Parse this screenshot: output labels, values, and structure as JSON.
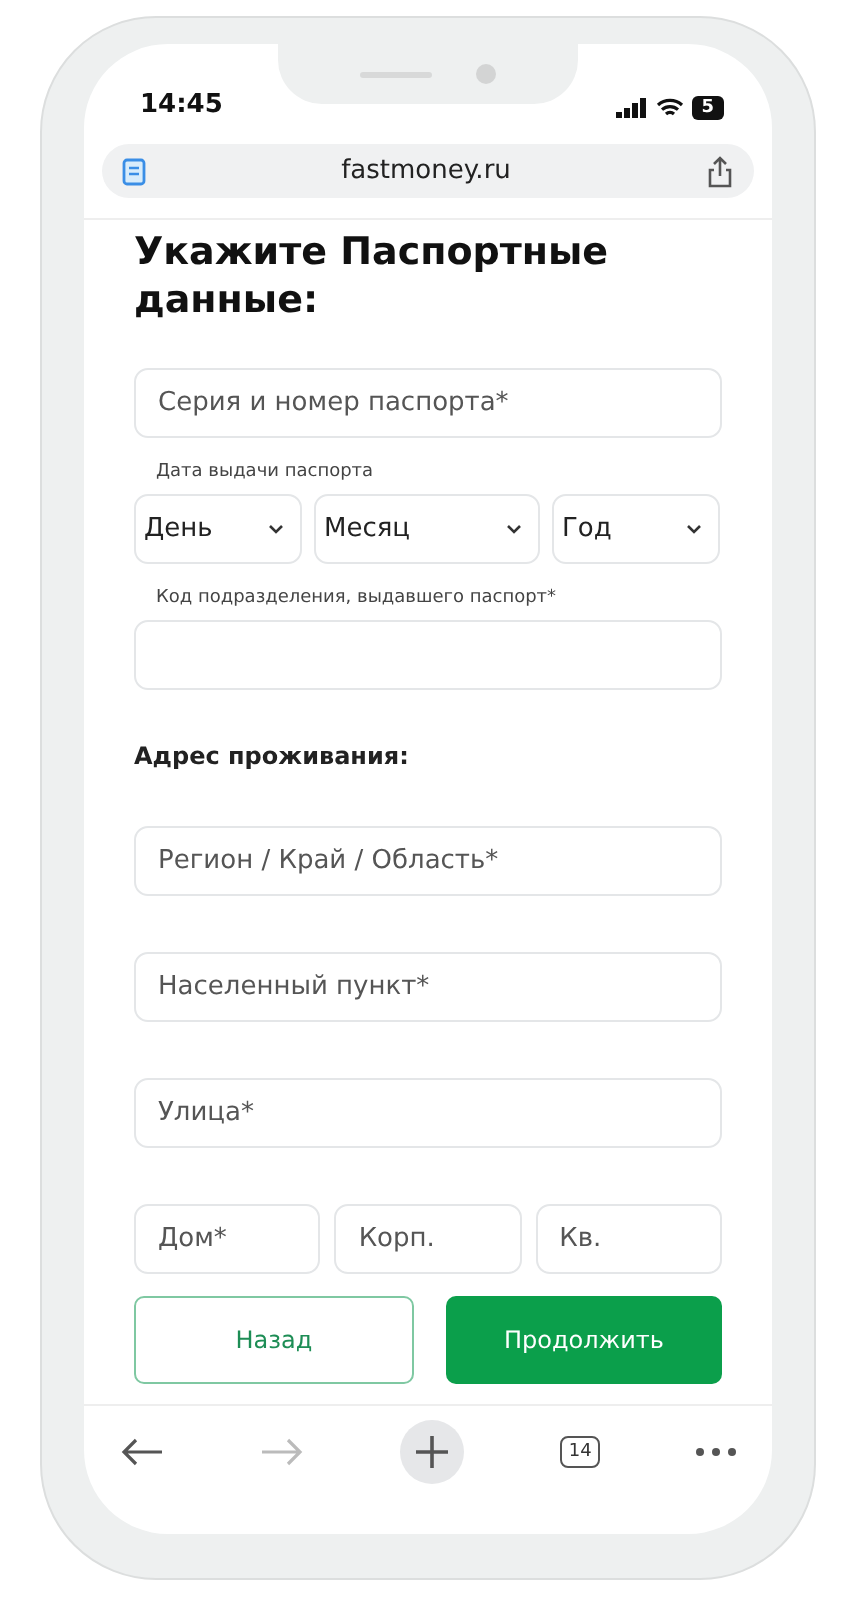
{
  "status_bar": {
    "time": "14:45",
    "battery": "5"
  },
  "address_bar": {
    "url": "fastmoney.ru"
  },
  "form": {
    "title": "Укажите Паспортные данные:",
    "passport_number": {
      "placeholder": "Серия и номер паспорта*"
    },
    "issue_date": {
      "label": "Дата выдачи паспорта",
      "selects": [
        {
          "placeholder": "День"
        },
        {
          "placeholder": "Месяц"
        },
        {
          "placeholder": "Год"
        }
      ]
    },
    "division_code": {
      "label": "Код подразделения, выдавшего паспорт*"
    },
    "address_heading": "Адрес проживания:",
    "address_fields": [
      {
        "placeholder": "Регион / Край / Область*"
      },
      {
        "placeholder": "Населенный пункт*"
      },
      {
        "placeholder": "Улица*"
      }
    ],
    "house_fields": [
      {
        "placeholder": "Дом*"
      },
      {
        "placeholder": "Корп."
      },
      {
        "placeholder": "Кв."
      }
    ],
    "buttons": [
      {
        "label": "Назад",
        "kind": "secondary"
      },
      {
        "label": "Продолжить",
        "kind": "primary"
      }
    ]
  },
  "toolbar": {
    "tabs_count": "14"
  }
}
